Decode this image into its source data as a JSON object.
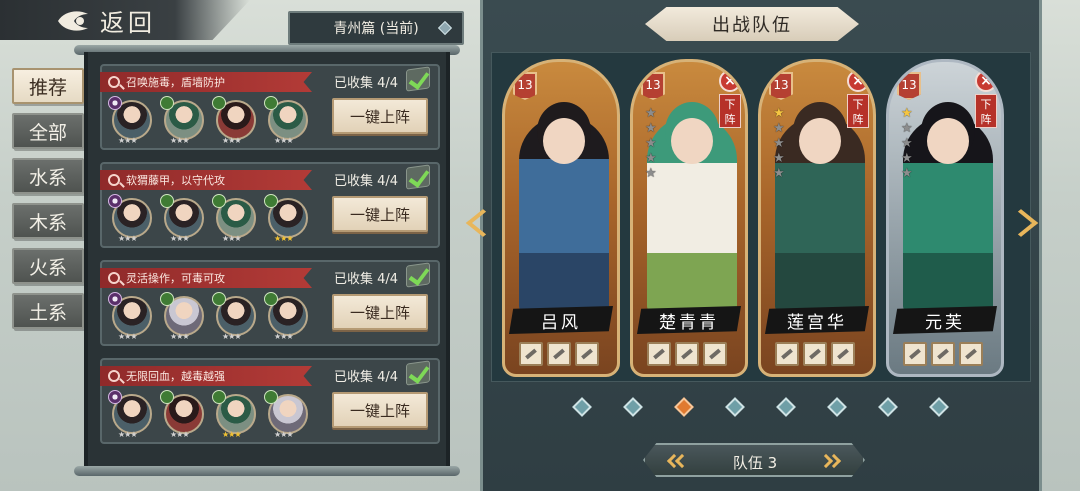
{
  "back": {
    "label": "返回"
  },
  "chapter": {
    "label": "青州篇 (当前)"
  },
  "tabs": [
    {
      "label": "推荐",
      "active": true
    },
    {
      "label": "全部",
      "active": false
    },
    {
      "label": "水系",
      "active": false
    },
    {
      "label": "木系",
      "active": false
    },
    {
      "label": "火系",
      "active": false
    },
    {
      "label": "土系",
      "active": false
    }
  ],
  "lineups": [
    {
      "desc": "召唤施毒，盾墙防护",
      "collected": "已收集 4/4",
      "button": "一键上阵",
      "avatars": [
        {
          "element": "yin-yang",
          "stars": 3,
          "gold": false
        },
        {
          "element": "wood",
          "stars": 3,
          "gold": false
        },
        {
          "element": "wood",
          "stars": 3,
          "gold": false
        },
        {
          "element": "wood",
          "stars": 3,
          "gold": false
        }
      ]
    },
    {
      "desc": "软猬藤甲，以守代攻",
      "collected": "已收集 4/4",
      "button": "一键上阵",
      "avatars": [
        {
          "element": "yin-yang",
          "stars": 3,
          "gold": false
        },
        {
          "element": "wood",
          "stars": 3,
          "gold": false
        },
        {
          "element": "wood",
          "stars": 3,
          "gold": false
        },
        {
          "element": "wood",
          "stars": 3,
          "gold": true
        }
      ]
    },
    {
      "desc": "灵活操作，可毒可攻",
      "collected": "已收集 4/4",
      "button": "一键上阵",
      "avatars": [
        {
          "element": "yin-yang",
          "stars": 3,
          "gold": false
        },
        {
          "element": "wood",
          "stars": 3,
          "gold": false
        },
        {
          "element": "wood",
          "stars": 3,
          "gold": false
        },
        {
          "element": "wood",
          "stars": 3,
          "gold": false
        }
      ]
    },
    {
      "desc": "无限回血，越毒越强",
      "collected": "已收集 4/4",
      "button": "一键上阵",
      "avatars": [
        {
          "element": "yin-yang",
          "stars": 3,
          "gold": false
        },
        {
          "element": "wood",
          "stars": 3,
          "gold": false
        },
        {
          "element": "wood",
          "stars": 3,
          "gold": true
        },
        {
          "element": "wood",
          "stars": 3,
          "gold": false
        }
      ]
    }
  ],
  "team": {
    "title": "出战队伍",
    "switch_label": "队伍 3",
    "page_count": 8,
    "active_page": 2,
    "heroes": [
      {
        "name": "吕风",
        "level": "13",
        "stars_on": 0,
        "stars_total": 0,
        "removable": false,
        "remove_label": "",
        "theme": "orange"
      },
      {
        "name": "楚青青",
        "level": "13",
        "stars_on": 0,
        "stars_total": 5,
        "removable": true,
        "remove_label": "下阵",
        "theme": "orange"
      },
      {
        "name": "莲宫华",
        "level": "13",
        "stars_on": 1,
        "stars_total": 5,
        "removable": true,
        "remove_label": "下阵",
        "theme": "orange"
      },
      {
        "name": "元芙",
        "level": "13",
        "stars_on": 1,
        "stars_total": 5,
        "removable": true,
        "remove_label": "下阵",
        "theme": "blue"
      }
    ]
  },
  "colors": {
    "accent": "#e8b65b",
    "remove": "#c73a32",
    "ribbon": "#b33b37",
    "check": "#7ed957"
  }
}
